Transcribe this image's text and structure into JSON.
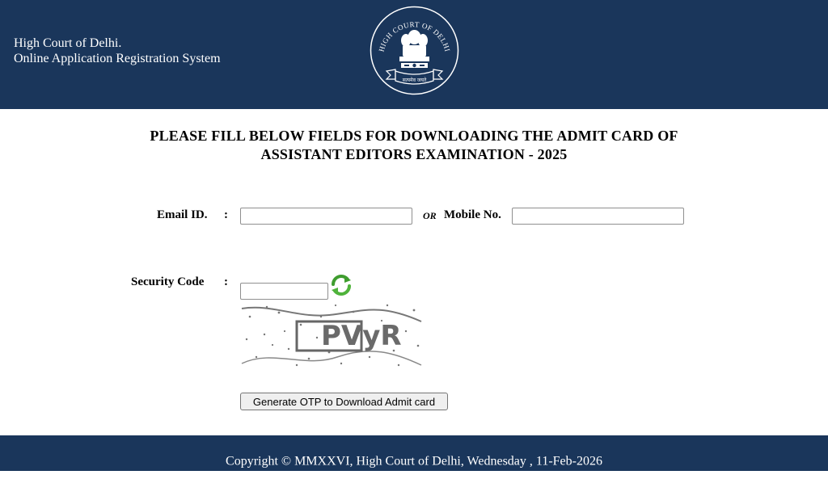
{
  "header": {
    "org_name": "High Court of Delhi.",
    "system_name": "Online Application Registration System",
    "emblem_ring_text": "HIGH COURT OF DELHI",
    "emblem_motto": "सत्यमेव जयते"
  },
  "page": {
    "title_line1": "PLEASE FILL BELOW FIELDS FOR DOWNLOADING THE ADMIT CARD OF",
    "title_line2": "ASSISTANT EDITORS EXAMINATION - 2025"
  },
  "form": {
    "email_label": "Email ID.",
    "email_colon": ":",
    "email_value": "",
    "or_label": "OR",
    "mobile_label": "Mobile No.",
    "mobile_value": "",
    "security_label": "Security Code",
    "security_colon": ":",
    "security_value": "",
    "refresh_icon": "refresh-icon",
    "captcha_text": "PVyR",
    "submit_label": "Generate OTP to Download Admit card"
  },
  "footer": {
    "copyright": "Copyright © MMXXVI, High Court of Delhi, Wednesday , 11-Feb-2026"
  },
  "colors": {
    "header_bg": "#1a365b",
    "footer_bg": "#1a365b",
    "refresh_green": "#3f9d2f"
  }
}
